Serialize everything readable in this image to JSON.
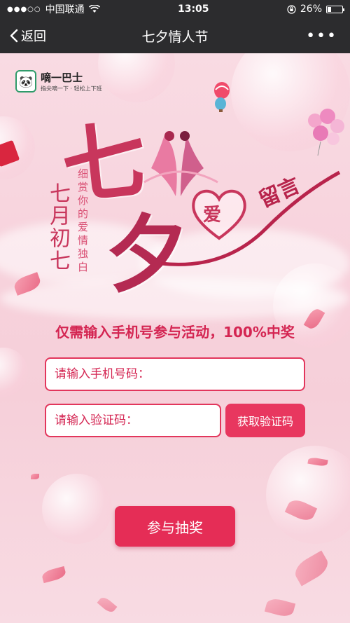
{
  "status_bar": {
    "carrier": "中国联通",
    "time": "13:05",
    "battery": "26%",
    "battery_level": 0.26
  },
  "nav": {
    "back_label": "返回",
    "title": "七夕情人节",
    "more_label": "•••"
  },
  "logo": {
    "name": "嘀一巴士",
    "slogan": "指尖嘀一下 · 轻松上下班"
  },
  "hero": {
    "big_char_1": "七",
    "big_char_2": "夕",
    "date_text": "七月初七",
    "tagline": "细赏你的爱情独白",
    "heart_text": "爱",
    "message_text": "留言"
  },
  "form": {
    "slogan": "仅需输入手机号参与活动，100%中奖",
    "phone_placeholder": "请输入手机号码：",
    "code_placeholder": "请输入验证码：",
    "get_code_label": "获取验证码",
    "submit_label": "参与抽奖"
  },
  "colors": {
    "accent": "#e52d56",
    "text_red": "#d42552",
    "bar_bg": "#2c2c2e"
  }
}
